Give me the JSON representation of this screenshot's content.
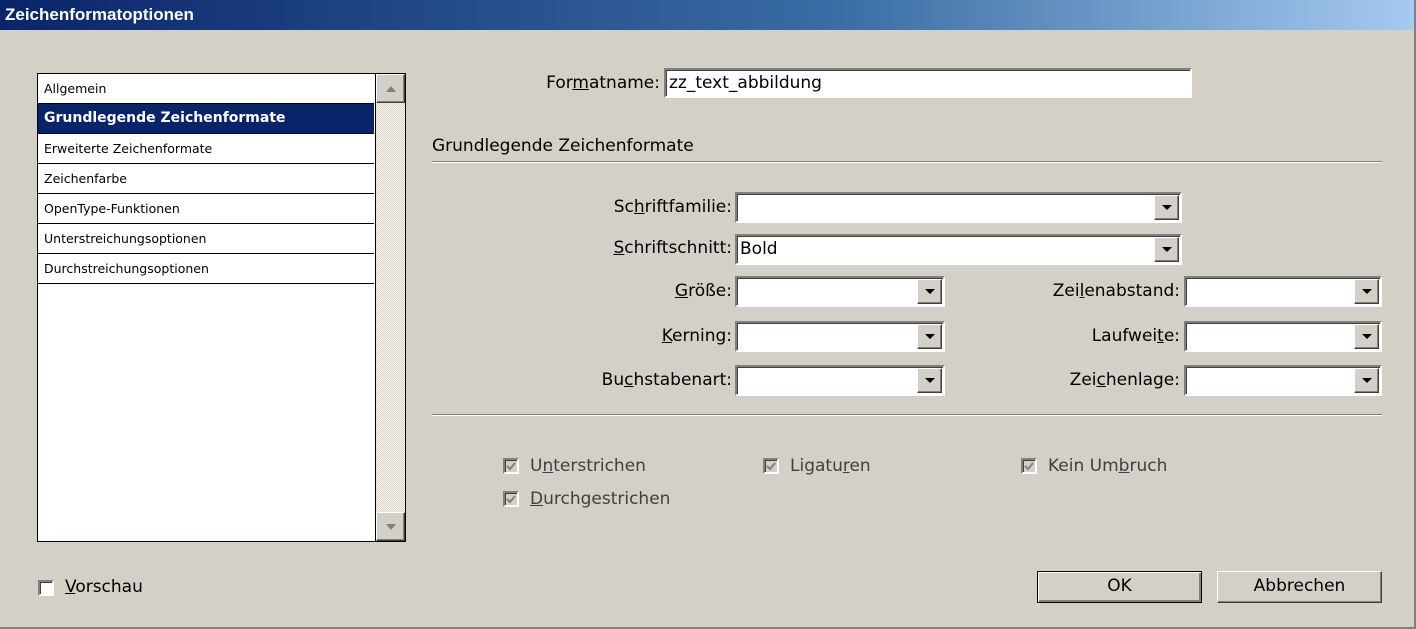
{
  "window": {
    "title": "Zeichenformatoptionen"
  },
  "sidebar": {
    "items": [
      {
        "label": "Allgemein"
      },
      {
        "label": "Grundlegende Zeichenformate"
      },
      {
        "label": "Erweiterte Zeichenformate"
      },
      {
        "label": "Zeichenfarbe"
      },
      {
        "label": "OpenType-Funktionen"
      },
      {
        "label": "Unterstreichungsoptionen"
      },
      {
        "label": "Durchstreichungsoptionen"
      }
    ]
  },
  "form": {
    "formatname_label_a": "For",
    "formatname_label_u": "m",
    "formatname_label_b": "atname:",
    "formatname_value": "zz_text_abbildung",
    "section_title": "Grundlegende Zeichenformate",
    "schriftfamilie": {
      "label_a": "Sc",
      "label_u": "h",
      "label_b": "riftfamilie:",
      "value": ""
    },
    "schriftschnitt": {
      "label_a": "",
      "label_u": "S",
      "label_b": "chriftschnitt:",
      "value": "Bold"
    },
    "groesse": {
      "label_a": "",
      "label_u": "G",
      "label_b": "röße:",
      "value": ""
    },
    "zeilenabstand": {
      "label_a": "Zei",
      "label_u": "l",
      "label_b": "enabstand:",
      "value": ""
    },
    "kerning": {
      "label_a": "",
      "label_u": "K",
      "label_b": "erning:",
      "value": ""
    },
    "laufweite": {
      "label_a": "Laufwei",
      "label_u": "t",
      "label_b": "e:",
      "value": ""
    },
    "buchstabenart": {
      "label_a": "Bu",
      "label_u": "c",
      "label_b": "hstabenart:",
      "value": ""
    },
    "zeichenlage": {
      "label_a": "Zei",
      "label_u": "c",
      "label_b": "henlage:",
      "value": ""
    }
  },
  "checkboxes": {
    "unterstrichen": {
      "label_a": "U",
      "label_u": "n",
      "label_b": "terstrichen",
      "checked": true
    },
    "ligaturen": {
      "label_a": "Ligatu",
      "label_u": "r",
      "label_b": "en",
      "checked": true
    },
    "kein_umbruch": {
      "label_a": "Kein Um",
      "label_u": "b",
      "label_b": "ruch",
      "checked": true
    },
    "durchgestrichen": {
      "label_a": "",
      "label_u": "D",
      "label_b": "urchgestrichen",
      "checked": true
    },
    "vorschau": {
      "label_a": "",
      "label_u": "V",
      "label_b": "orschau",
      "checked": false
    }
  },
  "buttons": {
    "ok": "OK",
    "cancel": "Abbrechen"
  }
}
